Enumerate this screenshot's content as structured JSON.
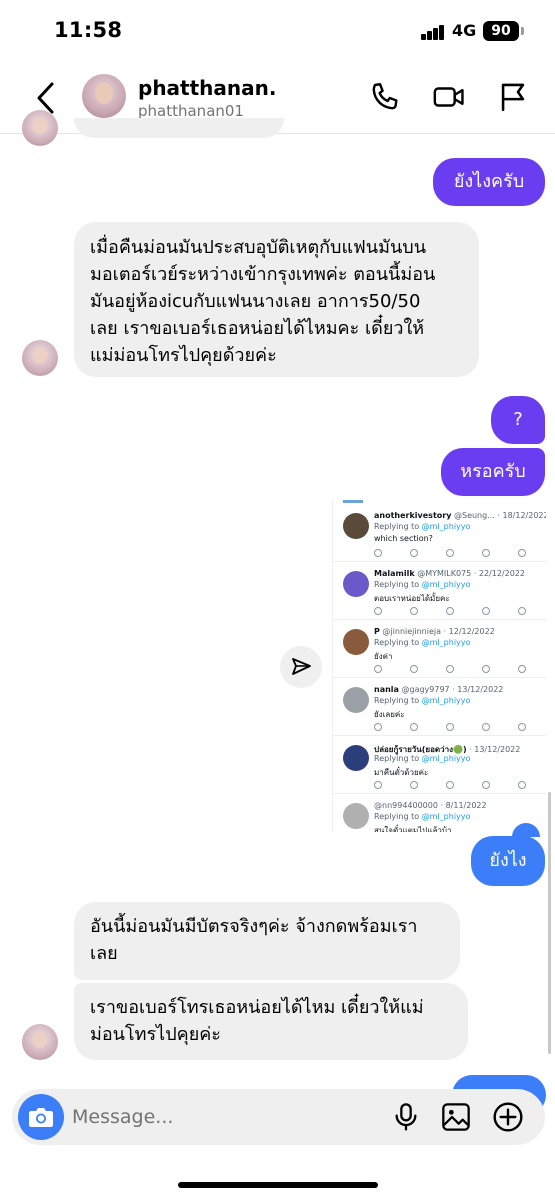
{
  "status_bar": {
    "time": "11:58",
    "network": "4G",
    "battery": "90"
  },
  "header": {
    "name": "phatthanan.",
    "username": "phatthanan01"
  },
  "messages": {
    "out_1": "ยังไงครับ",
    "in_1": [
      "เมื่อคืนม่อนมันประสบอุบัติเหตุกับแฟนมันบน",
      "มอเตอร์เวย์ระหว่างเข้ากรุงเทพค่ะ ตอนนี้ม่อน",
      "มันอยู่ห้องicuกับแฟนนางเลย อาการ50/50",
      "เลย เราขอเบอร์เธอหน่อยได้ไหมคะ เดี๋ยวให้",
      "แม่ม่อนโทรไปคุยด้วยค่ะ"
    ],
    "out_2": "?",
    "out_3": "หรอครับ",
    "out_4": "ยังไง",
    "in_2": [
      "อันนี้ม่อนมันมีบัตรจริงๆค่ะ จ้างกดพร้อมเรา",
      "เลย"
    ],
    "in_3": [
      "เราขอเบอร์โทรเธอหน่อยได้ไหม เดี๋ยวให้แม่",
      "ม่อนโทรไปคุยค่ะ"
    ]
  },
  "shared_tweets": [
    {
      "name": "anotherkivestory",
      "handle": "@Seung...",
      "date": "18/12/2022",
      "reply_label": "Replying to",
      "reply_to": "@ml_phiyyo",
      "text": "which section?",
      "avatar_color": "#5a4a3a"
    },
    {
      "name": "Malamilk",
      "handle": "@MYMILK075",
      "date": "22/12/2022",
      "reply_label": "Replying to",
      "reply_to": "@ml_phiyyo",
      "text": "ตอบเราหน่อยได้มั้ยคะ",
      "avatar_color": "#6b58c9"
    },
    {
      "name": "P",
      "handle": "@jinniejinnieja",
      "date": "12/12/2022",
      "reply_label": "Replying to",
      "reply_to": "@ml_phiyyo",
      "text": "ยังค่า",
      "avatar_color": "#8a5a3c"
    },
    {
      "name": "nanla",
      "handle": "@gagy9797",
      "date": "13/12/2022",
      "reply_label": "Replying to",
      "reply_to": "@ml_phiyyo",
      "text": "ยังเลยค่ะ",
      "avatar_color": "#9aa0a6"
    },
    {
      "name": "ปล่อยกู้รายวัน(ยอดว่าง🟢)",
      "handle": "",
      "date": "13/12/2022",
      "reply_label": "Replying to",
      "reply_to": "@ml_phiyyo",
      "text": "มาคืนตั๋วด้วยค่ะ",
      "avatar_color": "#2d3f7a"
    },
    {
      "name": "",
      "handle": "@nn994400000",
      "date": "8/11/2022",
      "reply_label": "Replying to",
      "reply_to": "@ml_phiyyo",
      "text": "สนใจตั๋วแตมไปแล้วบ้า",
      "avatar_color": "#b0b0b0"
    }
  ],
  "composer": {
    "placeholder": "Message..."
  },
  "colors": {
    "purple_bubble": "#6a3df0",
    "blue_bubble": "#3b7ef8",
    "incoming_bubble": "#efefef"
  }
}
